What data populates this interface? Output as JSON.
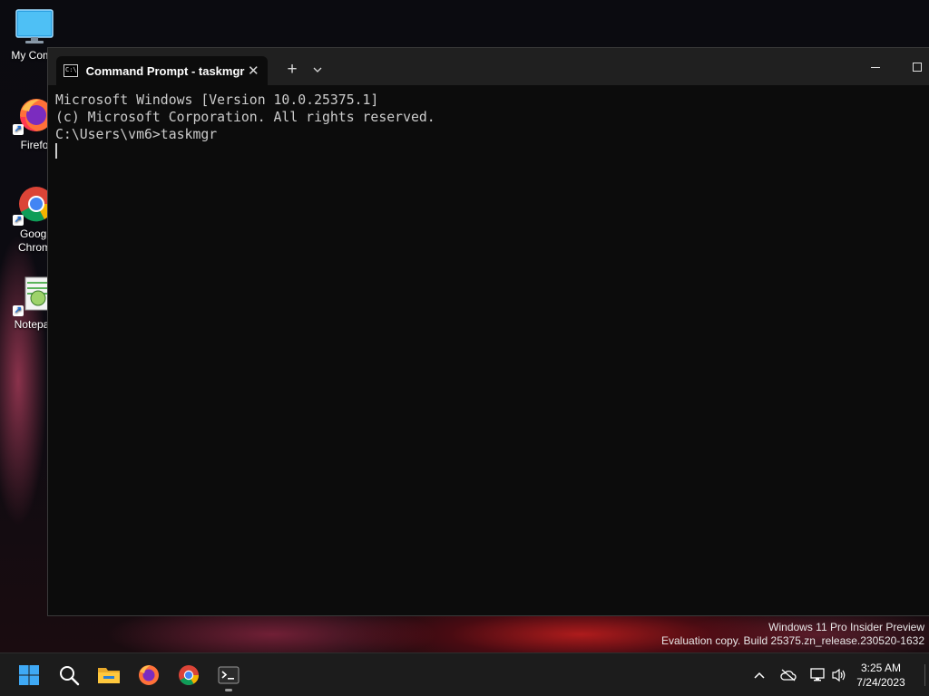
{
  "desktop": {
    "icons": [
      {
        "label": "My Comp",
        "icon": "monitor-icon"
      },
      {
        "label": "Firefo",
        "icon": "firefox-icon"
      },
      {
        "label": "Googl\nChrom",
        "icon": "chrome-icon"
      },
      {
        "label": "Notepac",
        "icon": "notepad-icon"
      }
    ]
  },
  "window": {
    "tab_title": "Command Prompt - taskmgr",
    "tab_close": "✕",
    "new_tab": "+",
    "console_lines": [
      "Microsoft Windows [Version 10.0.25375.1]",
      "(c) Microsoft Corporation. All rights reserved.",
      "",
      "C:\\Users\\vm6>taskmgr"
    ]
  },
  "watermark": {
    "line1": "Windows 11 Pro Insider Preview",
    "line2": "Evaluation copy. Build 25375.zn_release.230520-1632"
  },
  "taskbar": {
    "items": [
      "start-icon",
      "search-icon",
      "file-explorer-icon",
      "firefox-icon",
      "chrome-icon",
      "terminal-icon"
    ],
    "tray": [
      "chevron-up-icon",
      "cloud-off-icon",
      "network-icon",
      "volume-icon"
    ],
    "time": "3:25 AM",
    "date": "7/24/2023"
  },
  "colors": {
    "console_bg": "#0c0c0c",
    "console_text": "#cccccc",
    "titlebar_bg": "#202020",
    "taskbar_bg": "#1c1c1c"
  }
}
